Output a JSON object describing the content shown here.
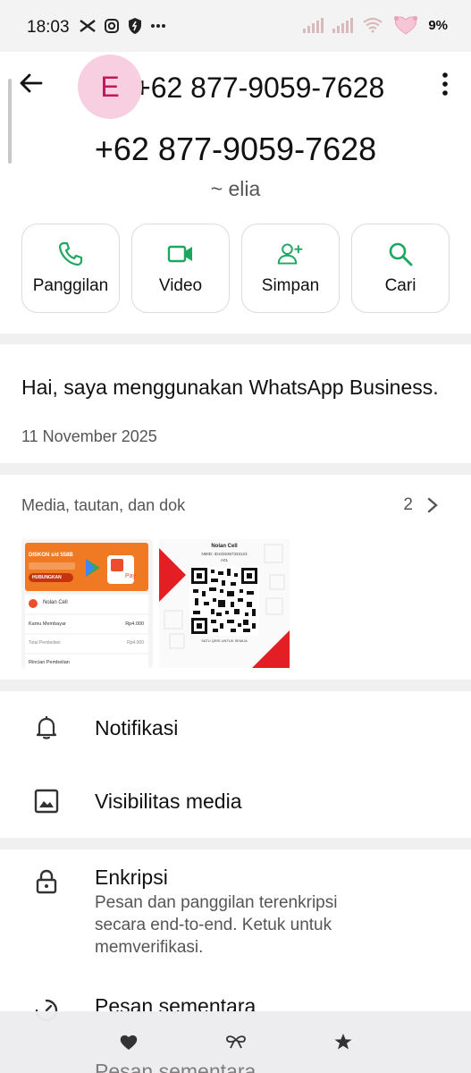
{
  "status_bar": {
    "time": "18:03",
    "icons": [
      "capcut-icon",
      "instagram-icon",
      "shield-icon",
      "more-dots-icon"
    ],
    "battery": "9%"
  },
  "header": {
    "avatar_letter": "E",
    "title": "+62 877-9059-7628",
    "phone": "+62 877-9059-7628",
    "name": "~ elia"
  },
  "actions": [
    {
      "label": "Panggilan",
      "icon": "phone-icon"
    },
    {
      "label": "Video",
      "icon": "video-icon"
    },
    {
      "label": "Simpan",
      "icon": "add-contact-icon"
    },
    {
      "label": "Cari",
      "icon": "search-icon"
    }
  ],
  "about": {
    "text": "Hai, saya menggunakan WhatsApp Business.",
    "date": "11 November 2025"
  },
  "media": {
    "title": "Media, tautan, dan dok",
    "count": "2",
    "thumb1": {
      "banner": "DISKON s/d 558B",
      "button": "HUBUNGKAN",
      "pay": "Pay",
      "merchant": "Nolan Cell",
      "row1_label": "Kamu Membayar",
      "row1_value": "Rp4.000",
      "row2_label": "Total Pembelian",
      "row2_value": "Rp4.000",
      "row3_label": "Rincian Pembelian"
    },
    "thumb2": {
      "merchant": "Nolan Cell",
      "nmid": "NMID: ID1025367333123",
      "code": "A01",
      "footer": "SATU QRIS UNTUK SEMUA"
    }
  },
  "settings": {
    "notifications": "Notifikasi",
    "media_visibility": "Visibilitas media",
    "encryption_title": "Enkripsi",
    "encryption_desc": "Pesan dan panggilan terenkripsi secara end-to-end. Ketuk untuk memverifikasi.",
    "disappearing": "Pesan sementara"
  },
  "bottom_bar": {
    "icons": [
      "heart-icon",
      "bow-icon",
      "star-icon"
    ],
    "ghost_text": "Pesan sementara"
  },
  "colors": {
    "accent_green": "#1da660",
    "avatar_bg": "#f7cfe0",
    "avatar_text": "#c2185b",
    "page_bg": "#f0f0f0"
  }
}
